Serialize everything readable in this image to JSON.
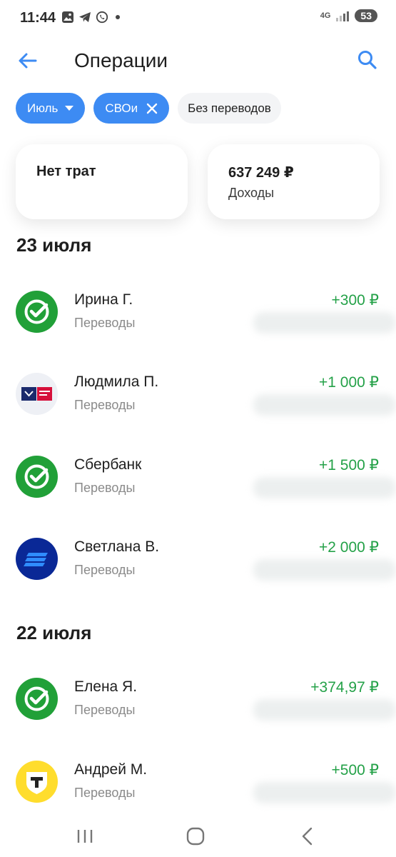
{
  "status": {
    "time": "11:44",
    "network": "4G",
    "battery": "53"
  },
  "header": {
    "title": "Операции"
  },
  "filters": [
    {
      "label": "Июль"
    },
    {
      "label": "СВОи"
    },
    {
      "label": "Без переводов"
    }
  ],
  "summary": {
    "spend": {
      "label": "Нет трат"
    },
    "income": {
      "amount": "637 249 ₽",
      "label": "Доходы"
    }
  },
  "groups": [
    {
      "date": "23 июля",
      "operations": [
        {
          "name": "Ирина Г.",
          "category": "Переводы",
          "amount": "+300 ₽",
          "logo": "sber-icon"
        },
        {
          "name": "Людмила П.",
          "category": "Переводы",
          "amount": "+1 000 ₽",
          "logo": "pochta-bank-icon"
        },
        {
          "name": "Сбербанк",
          "category": "Переводы",
          "amount": "+1 500 ₽",
          "logo": "sber-icon"
        },
        {
          "name": "Светлана В.",
          "category": "Переводы",
          "amount": "+2 000 ₽",
          "logo": "vtb-icon"
        }
      ]
    },
    {
      "date": "22 июля",
      "operations": [
        {
          "name": "Елена Я.",
          "category": "Переводы",
          "amount": "+374,97 ₽",
          "logo": "sber-icon"
        },
        {
          "name": "Андрей М.",
          "category": "Переводы",
          "amount": "+500 ₽",
          "logo": "tinkoff-icon"
        }
      ]
    }
  ],
  "colors": {
    "accent": "#3d8bf3",
    "income": "#24a148",
    "sber": "#21a038",
    "vtb": "#0a2896",
    "tinkoff": "#ffdd2d"
  }
}
